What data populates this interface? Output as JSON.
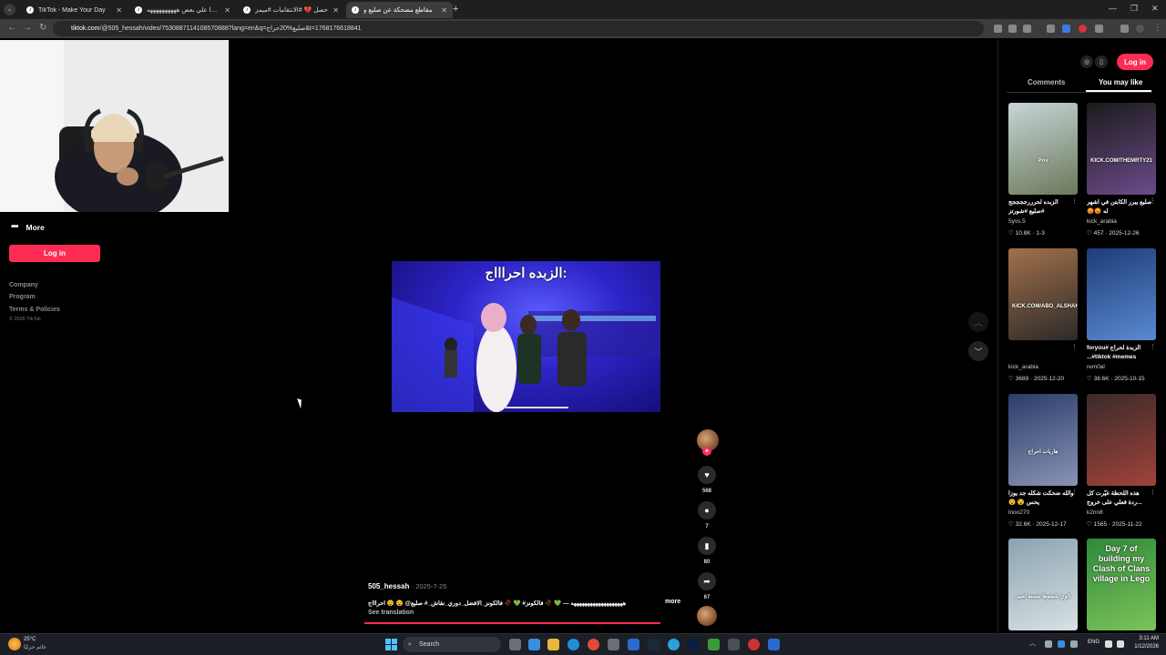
{
  "browser": {
    "tabs": [
      {
        "title": "TikTok - Make Your Day",
        "active": false
      },
      {
        "title": "قلبوا علي بعض ههههههههههه",
        "active": false
      },
      {
        "title": "حصل 💔 #الانتقامات #ميمز",
        "active": false
      },
      {
        "title": "مقاطع مضحكة عن صليع و",
        "active": true
      }
    ],
    "url_site": "tiktok.com",
    "url_rest": "/@505_hessah/video/7530887114108570888?lang=en&q=صليع%20حراج&t=1768176618841"
  },
  "sidebar": {
    "more_label": "More",
    "login_label": "Log in",
    "footer_links": [
      "Company",
      "Program",
      "Terms & Policies"
    ],
    "copyright": "© 2026 TikTok"
  },
  "video": {
    "caption": "الزبده احراااج:",
    "author": "505_hessah",
    "date": "2025-7-25",
    "description": "هههههههههههههههههههه — 💚 🥀 فالكونز# 💚 🥀 فالكونز_الافضل_دوري_نقاش_# صليع@ 😵 😵 احراااج",
    "more_label": "more",
    "see_translation": "See translation",
    "likes": "568",
    "comments": "7",
    "saves": "80",
    "shares": "67"
  },
  "right_panel": {
    "login_label": "Log in",
    "tabs": [
      "Comments",
      "You may like"
    ],
    "active_tab": "You may like",
    "cards": [
      {
        "title": "الزبده لحرررججججج #صليع #شورتز",
        "user": "5yvs.5",
        "likes": "10.8K",
        "date": "1-3",
        "colors": [
          "#c9d4d8",
          "#6a7a5a"
        ],
        "overlay": "Pov"
      },
      {
        "title": "صليع يبرر الكابتن في اشهر له 😡😡",
        "user": "kick_arabia",
        "likes": "457",
        "date": "2025-12-26",
        "colors": [
          "#1b1b1b",
          "#6b4b8a"
        ],
        "overlay": "KICK.COM/THEMRTY21"
      },
      {
        "title": "",
        "user": "kick_arabia",
        "likes": "3689",
        "date": "2025-12-20",
        "colors": [
          "#a2704a",
          "#2c2a2a"
        ],
        "overlay": "KICK.COM/ABO_ALSHAHAB"
      },
      {
        "title": "الزبدة لحراج #foryou #tiktok #memes...",
        "user": "rem0al",
        "likes": "38.6K",
        "date": "2025-10-15",
        "colors": [
          "#1e3c78",
          "#5a8ad0"
        ],
        "overlay": ""
      },
      {
        "title": "والله ضحكت شكله جد يوزا يحس 😵 😵",
        "user": "lnoo270",
        "likes": "32.6K",
        "date": "2025-12-17",
        "colors": [
          "#2a3d6a",
          "#8a93b5"
        ],
        "overlay": "هاربات احراج"
      },
      {
        "title": "هذه اللحظة غيّرت كل ...ردة فعلي على خروج",
        "user": "k2nn8",
        "likes": "1565",
        "date": "2025-11-22",
        "colors": [
          "#3a2a2a",
          "#a0433a"
        ],
        "overlay": ""
      },
      {
        "title": "",
        "user": "",
        "likes": "",
        "date": "",
        "colors": [
          "#8aa3b0",
          "#d9e1e4"
        ],
        "overlay": "الوي شفتوها بنسبه اصير"
      },
      {
        "title": "",
        "user": "",
        "likes": "",
        "date": "",
        "colors": [
          "#2f8a3a",
          "#7cc35a"
        ],
        "overlay": "Day 7 of building my Clash of Clans village in Lego"
      }
    ]
  },
  "taskbar": {
    "weather_temp": "25°C",
    "weather_desc": "غائم جزئيًا",
    "search_placeholder": "Search",
    "lang": "ENG",
    "time": "3:11 AM",
    "date": "1/12/2026"
  }
}
